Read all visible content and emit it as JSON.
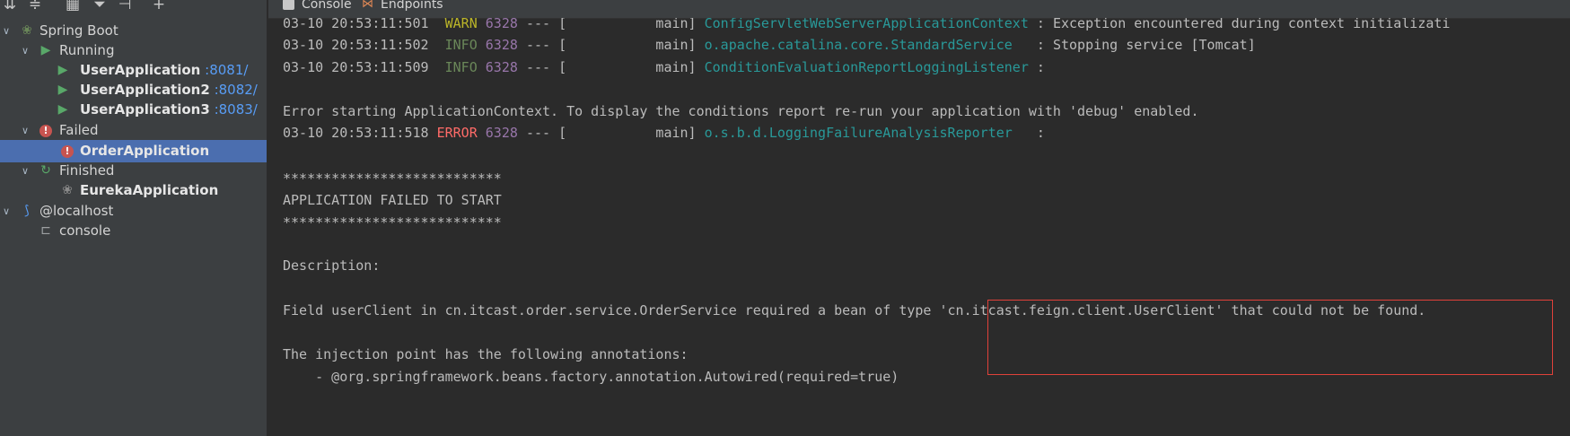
{
  "sidebar": {
    "toolbar_icons": [
      "collapse-all-icon",
      "expand-all-icon",
      "group-icon",
      "filter-icon",
      "layout-icon",
      "add-icon"
    ],
    "tree": {
      "spring_boot": "Spring Boot",
      "running": "Running",
      "running_apps": [
        {
          "name": "UserApplication",
          "port": ":8081/"
        },
        {
          "name": "UserApplication2",
          "port": ":8082/"
        },
        {
          "name": "UserApplication3",
          "port": ":8083/"
        }
      ],
      "failed": "Failed",
      "failed_app": "OrderApplication",
      "finished": "Finished",
      "finished_app": "EurekaApplication",
      "localhost": "@localhost",
      "console": "console"
    }
  },
  "tabs": {
    "console": "Console",
    "endpoints": "Endpoints"
  },
  "console": {
    "lines": [
      {
        "ts": "03-10 20:53:11:501",
        "level": "WARN",
        "pid": "6328",
        "sep": "---",
        "thread": "[           main]",
        "logger": "ConfigServletWebServerApplicationContext",
        "msg": ": Exception encountered during context initializati"
      },
      {
        "ts": "03-10 20:53:11:502",
        "level": "INFO",
        "pid": "6328",
        "sep": "---",
        "thread": "[           main]",
        "logger": "o.apache.catalina.core.StandardService",
        "msg": ": Stopping service [Tomcat]"
      },
      {
        "ts": "03-10 20:53:11:509",
        "level": "INFO",
        "pid": "6328",
        "sep": "---",
        "thread": "[           main]",
        "logger": "ConditionEvaluationReportLoggingListener",
        "msg": ":"
      }
    ],
    "error_starting": "Error starting ApplicationContext. To display the conditions report re-run your application with 'debug' enabled.",
    "error_line": {
      "ts": "03-10 20:53:11:518",
      "level": "ERROR",
      "pid": "6328",
      "sep": "---",
      "thread": "[           main]",
      "logger": "o.s.b.d.LoggingFailureAnalysisReporter",
      "msg": ":"
    },
    "stars": "***************************",
    "failed_title": "APPLICATION FAILED TO START",
    "description_label": "Description:",
    "field_message": "Field userClient in cn.itcast.order.service.OrderService required a bean of type 'cn.itcast.feign.client.UserClient' that could not be found.",
    "injection_point": "The injection point has the following annotations:",
    "annotation": "    - @org.springframework.beans.factory.annotation.Autowired(required=true)"
  },
  "colors": {
    "highlight_box": "#e0413a",
    "selected_row": "#4b6eaf",
    "warn": "#bbb529",
    "info": "#6a8759",
    "error": "#ff6b68",
    "logger": "#299999"
  }
}
